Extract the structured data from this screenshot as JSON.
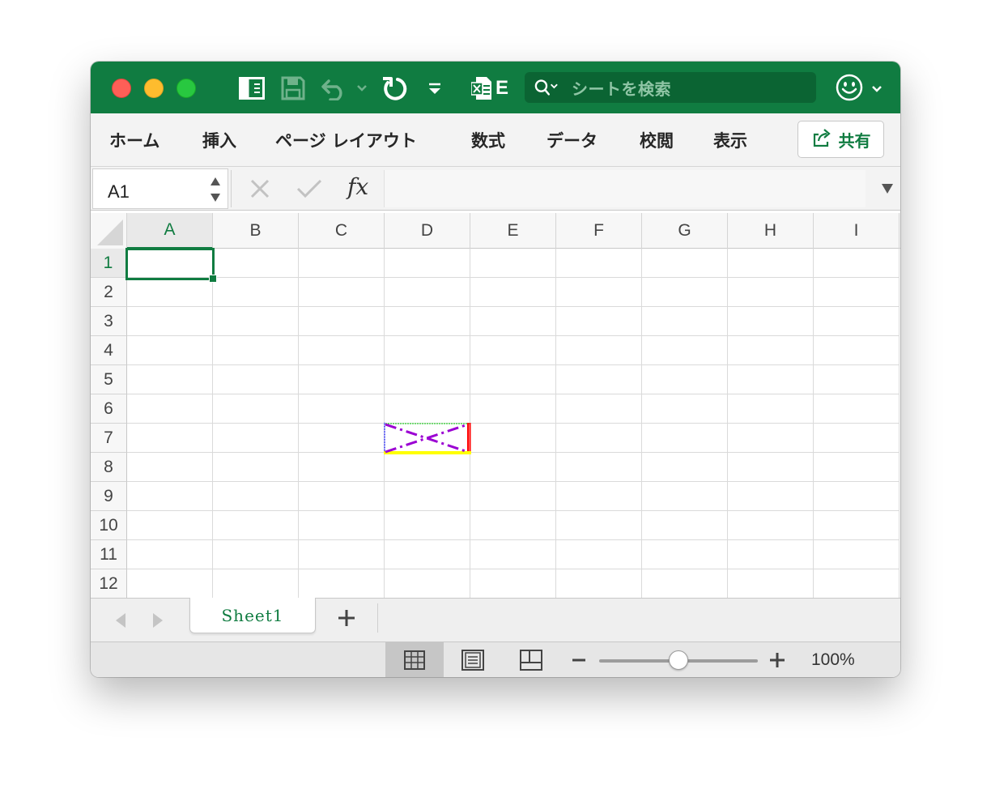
{
  "title_bar": {
    "icons": [
      "sidebar-icon",
      "save-icon",
      "undo-icon",
      "undo-dropdown-icon",
      "redo-icon",
      "customize-toolbar-icon",
      "excel-file-icon"
    ],
    "file_badge": "E",
    "search_placeholder": "シートを検索",
    "account_icon": "smiley-icon",
    "accent_color": "#107c41"
  },
  "ribbon": {
    "tabs": [
      "ホーム",
      "挿入",
      "ページ レイアウト",
      "数式",
      "データ",
      "校閲",
      "表示"
    ],
    "share_label": "共有"
  },
  "formula_bar": {
    "name_box": "A1",
    "fx_label": "fx",
    "formula": ""
  },
  "grid": {
    "columns": [
      "A",
      "B",
      "C",
      "D",
      "E",
      "F",
      "G",
      "H",
      "I"
    ],
    "rows": [
      "1",
      "2",
      "3",
      "4",
      "5",
      "6",
      "7",
      "8",
      "9",
      "10",
      "11",
      "12"
    ],
    "active_cell": "A1",
    "active_column": "A",
    "active_row": "1",
    "bordered_cell": {
      "cell": "D7",
      "top_border_color": "#00cc00",
      "left_border_color": "#0000ff",
      "right_border_color": "#ff0000",
      "bottom_border_color": "#ffff00",
      "diagonal_color": "#9b00d3"
    }
  },
  "sheet_tabs": {
    "tabs": [
      "Sheet1"
    ],
    "active": "Sheet1",
    "add_label": "+"
  },
  "status_bar": {
    "views": [
      "normal-view-icon",
      "page-layout-view-icon",
      "page-break-preview-icon"
    ],
    "active_view": "normal-view-icon",
    "zoom_percent": 100,
    "zoom_label": "100%"
  }
}
